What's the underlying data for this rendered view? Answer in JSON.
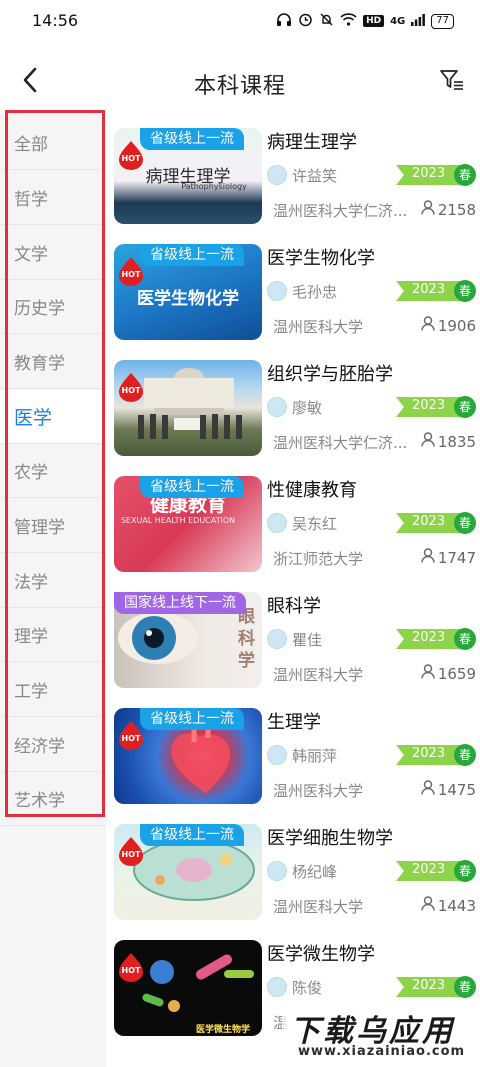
{
  "status_bar": {
    "time": "14:56",
    "icons": [
      "headphones-icon",
      "alarm-icon",
      "mute-icon",
      "wifi-icon"
    ],
    "hd": "HD",
    "network": "4G",
    "battery": "77"
  },
  "header": {
    "title": "本科课程",
    "back_icon": "chevron-left-icon",
    "filter_icon": "filter-icon"
  },
  "sidebar": {
    "items": [
      {
        "label": "全部"
      },
      {
        "label": "哲学"
      },
      {
        "label": "文学"
      },
      {
        "label": "历史学"
      },
      {
        "label": "教育学"
      },
      {
        "label": "医学"
      },
      {
        "label": "农学"
      },
      {
        "label": "管理学"
      },
      {
        "label": "法学"
      },
      {
        "label": "理学"
      },
      {
        "label": "工学"
      },
      {
        "label": "经济学"
      },
      {
        "label": "艺术学"
      }
    ],
    "active_index": 5,
    "active_color": "#1f7fd8"
  },
  "colors": {
    "tag_blue": "#1aa2e8",
    "tag_purple": "#a166e6",
    "year_green": "#8ed44a",
    "term_green": "#27a83a",
    "hot_red": "#e02020"
  },
  "courses": [
    {
      "title": "病理生理学",
      "tag": "省级线上一流",
      "thumb_title": "病理生理学",
      "thumb_sub": "Pathophysiology",
      "teacher": "许益笑",
      "year": "2023",
      "term": "春",
      "school": "温州医科大学仁济...",
      "count": "2158",
      "hot": "HOT"
    },
    {
      "title": "医学生物化学",
      "tag": "省级线上一流",
      "thumb_title": "医学生物化学",
      "thumb_sub": "",
      "teacher": "毛孙忠",
      "year": "2023",
      "term": "春",
      "school": "温州医科大学",
      "count": "1906",
      "hot": "HOT"
    },
    {
      "title": "组织学与胚胎学",
      "tag": "",
      "thumb_title": "",
      "thumb_sub": "",
      "teacher": "廖敏",
      "year": "2023",
      "term": "春",
      "school": "温州医科大学仁济...",
      "count": "1835",
      "hot": "HOT"
    },
    {
      "title": "性健康教育",
      "tag": "省级线上一流",
      "thumb_title": "健康教育",
      "thumb_sub": "SEXUAL HEALTH EDUCATION",
      "teacher": "吴东红",
      "year": "2023",
      "term": "春",
      "school": "浙江师范大学",
      "count": "1747",
      "hot": ""
    },
    {
      "title": "眼科学",
      "tag": "国家线上线下一流",
      "thumb_title": "眼科学",
      "thumb_sub": "",
      "teacher": "瞿佳",
      "year": "2023",
      "term": "春",
      "school": "温州医科大学",
      "count": "1659",
      "hot": ""
    },
    {
      "title": "生理学",
      "tag": "省级线上一流",
      "thumb_title": "",
      "thumb_sub": "",
      "teacher": "韩丽萍",
      "year": "2023",
      "term": "春",
      "school": "温州医科大学",
      "count": "1475",
      "hot": "HOT"
    },
    {
      "title": "医学细胞生物学",
      "tag": "省级线上一流",
      "thumb_title": "",
      "thumb_sub": "",
      "teacher": "杨纪峰",
      "year": "2023",
      "term": "春",
      "school": "温州医科大学",
      "count": "1443",
      "hot": "HOT"
    },
    {
      "title": "医学微生物学",
      "tag": "",
      "thumb_title": "医学微生物学",
      "thumb_sub": "",
      "teacher": "陈俊",
      "year": "2023",
      "term": "春",
      "school": "温",
      "count": "",
      "hot": "HOT"
    }
  ],
  "watermark": {
    "main": "下载乌应用",
    "sub": "www.xiazainiao.com"
  }
}
